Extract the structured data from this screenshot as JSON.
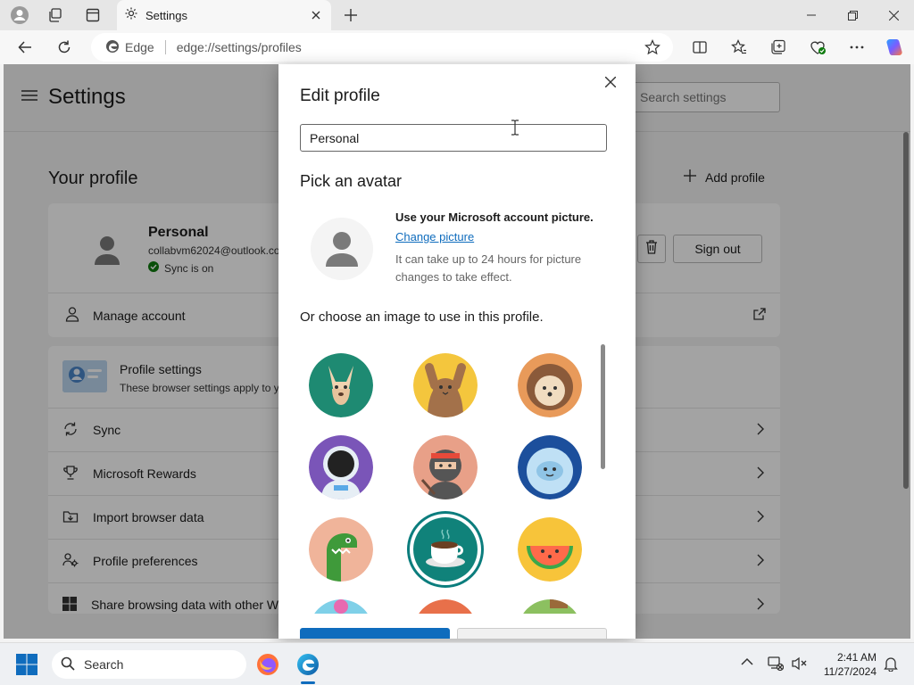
{
  "browser": {
    "tab_title": "Settings",
    "address_label": "Edge",
    "url": "edge://settings/profiles"
  },
  "settings": {
    "title": "Settings",
    "search_placeholder": "Search settings",
    "your_profile": "Your profile",
    "add_profile": "Add profile",
    "profile": {
      "name": "Personal",
      "email": "collabvm62024@outlook.co",
      "sync": "Sync is on"
    },
    "sign_out": "Sign out",
    "manage_account": "Manage account",
    "profile_settings_title": "Profile settings",
    "profile_settings_desc": "These browser settings apply to y",
    "rows": [
      {
        "label": "Sync"
      },
      {
        "label": "Microsoft Rewards"
      },
      {
        "label": "Import browser data"
      },
      {
        "label": "Profile preferences"
      },
      {
        "label": "Share browsing data with other W"
      }
    ]
  },
  "dialog": {
    "title": "Edit profile",
    "name_value": "Personal",
    "pick_avatar": "Pick an avatar",
    "account_picture": "Use your Microsoft account picture.",
    "change_picture": "Change picture",
    "note": "It can take up to 24 hours for picture changes to take effect.",
    "choose_image": "Or choose an image to use in this profile.",
    "avatars": [
      "dog",
      "cat",
      "hedgehog",
      "astronaut",
      "ninja",
      "yeti",
      "dinosaur",
      "coffee",
      "watermelon"
    ],
    "selected_avatar": "coffee"
  },
  "taskbar": {
    "search": "Search",
    "time": "2:41 AM",
    "date": "11/27/2024"
  },
  "colors": {
    "accent": "#0f6cbd",
    "selected_ring": "#0b7d7d",
    "sync_green": "#107c10"
  }
}
